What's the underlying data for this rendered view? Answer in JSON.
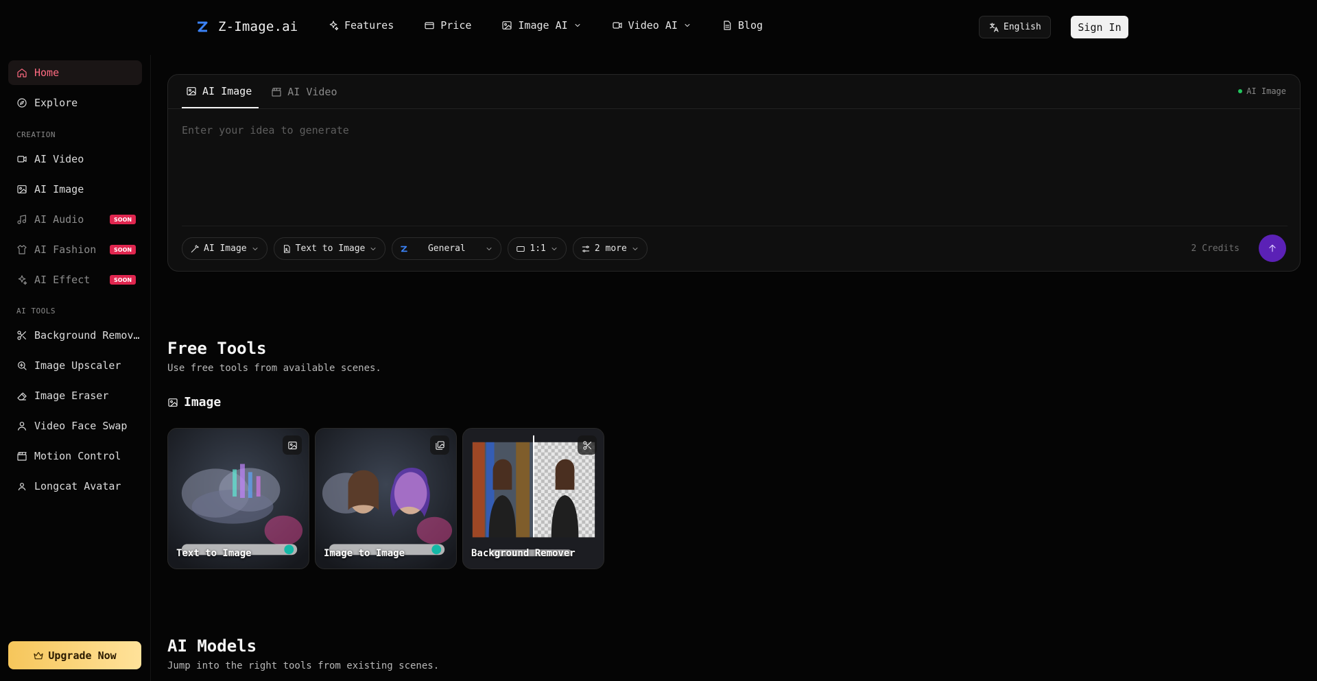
{
  "brand": {
    "name": "Z-Image.ai"
  },
  "nav": {
    "features": "Features",
    "price": "Price",
    "image_ai": "Image AI",
    "video_ai": "Video AI",
    "blog": "Blog"
  },
  "header": {
    "language": "English",
    "signin": "Sign In"
  },
  "sidebar": {
    "home": "Home",
    "explore": "Explore",
    "creation_label": "CREATION",
    "ai_video": "AI Video",
    "ai_image": "AI Image",
    "ai_audio": "AI Audio",
    "ai_fashion": "AI Fashion",
    "ai_effect": "AI Effect",
    "soon": "SOON",
    "tools_label": "AI TOOLS",
    "background_remover": "Background Remov…",
    "image_upscaler": "Image Upscaler",
    "image_eraser": "Image Eraser",
    "video_face_swap": "Video Face Swap",
    "motion_control": "Motion Control",
    "longcat_avatar": "Longcat Avatar",
    "upgrade": "Upgrade Now"
  },
  "generator": {
    "tab_image": "AI Image",
    "tab_video": "AI Video",
    "mode_indicator": "AI Image",
    "prompt_placeholder": "Enter your idea to generate",
    "ctl_type": "AI Image",
    "ctl_mode": "Text to Image",
    "ctl_model": "General",
    "ctl_ratio": "1:1",
    "ctl_more": "2 more",
    "credits": "2 Credits"
  },
  "free_tools": {
    "title": "Free Tools",
    "subtitle": "Use free tools from available scenes.",
    "category": "Image",
    "cards": [
      {
        "label": "Text to Image",
        "icon": "image-icon"
      },
      {
        "label": "Image to Image",
        "icon": "images-icon"
      },
      {
        "label": "Background Remover",
        "icon": "scissors-icon"
      }
    ]
  },
  "ai_models": {
    "title": "AI Models",
    "subtitle": "Jump into the right tools from existing scenes."
  },
  "colors": {
    "accent": "#ff6b81",
    "send": "#5b21b6",
    "soon": "#e0264f",
    "upgrade": "#f6c65b"
  }
}
